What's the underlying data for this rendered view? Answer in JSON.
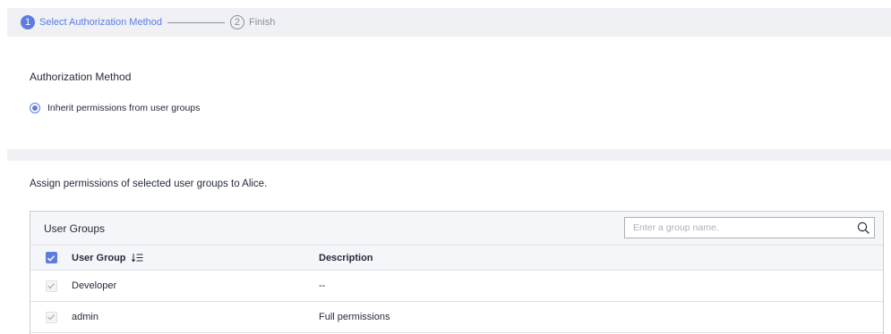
{
  "stepper": {
    "steps": [
      {
        "number": "1",
        "label": "Select Authorization Method",
        "state": "active"
      },
      {
        "number": "2",
        "label": "Finish",
        "state": "inactive"
      }
    ]
  },
  "auth": {
    "title": "Authorization Method",
    "option_label": "Inherit permissions from user groups",
    "option_selected": true
  },
  "assign_text": "Assign permissions of selected user groups to Alice.",
  "table": {
    "caption": "User Groups",
    "search_placeholder": "Enter a group name.",
    "columns": {
      "group": "User Group",
      "description": "Description"
    },
    "rows": [
      {
        "group": "Developer",
        "description": "--",
        "checked": true
      },
      {
        "group": "admin",
        "description": "Full permissions",
        "checked": true
      }
    ]
  },
  "colors": {
    "accent": "#5e7ce0",
    "header_bg": "#eff1f4",
    "muted": "#8a8e99"
  },
  "icons": {
    "search": "search-icon",
    "sort": "sort-icon",
    "check": "check-icon"
  }
}
